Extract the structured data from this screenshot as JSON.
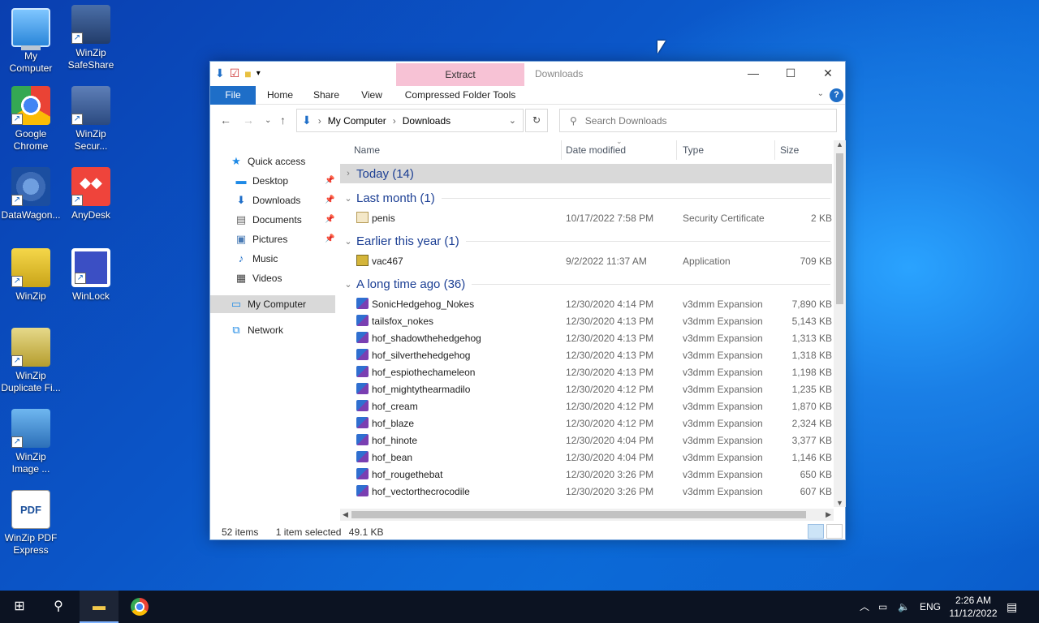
{
  "desktop": {
    "icons": [
      {
        "label": "My\nComputer",
        "l1": "My",
        "l2": "Computer"
      },
      {
        "l1": "WinZip",
        "l2": "SafeShare"
      },
      {
        "l1": "Google",
        "l2": "Chrome"
      },
      {
        "l1": "WinZip",
        "l2": "Secur..."
      },
      {
        "l1": "DataWagon...",
        "l2": ""
      },
      {
        "l1": "AnyDesk",
        "l2": ""
      },
      {
        "l1": "WinZip",
        "l2": ""
      },
      {
        "l1": "WinLock",
        "l2": ""
      },
      {
        "l1": "WinZip",
        "l2": "Duplicate Fi..."
      },
      {
        "l1": "WinZip",
        "l2": "Image ..."
      },
      {
        "l1": "WinZip PDF",
        "l2": "Express",
        "glyph": "PDF"
      }
    ]
  },
  "window": {
    "title": "Downloads",
    "extract_tab": "Extract",
    "ribbon_tabs": [
      "File",
      "Home",
      "Share",
      "View",
      "Compressed Folder Tools"
    ],
    "help": "?",
    "controls": {
      "minimize": "—",
      "maximize": "☐",
      "close": "✕"
    },
    "address": {
      "crumbs": [
        "My Computer",
        "Downloads"
      ],
      "sep": "›"
    },
    "search_placeholder": "Search Downloads"
  },
  "navpane": {
    "items": [
      {
        "label": "Quick access",
        "icon": "star-icon"
      },
      {
        "label": "Desktop",
        "icon": "desktop-icon",
        "pinned": true
      },
      {
        "label": "Downloads",
        "icon": "download-icon",
        "pinned": true
      },
      {
        "label": "Documents",
        "icon": "document-icon",
        "pinned": true
      },
      {
        "label": "Pictures",
        "icon": "pictures-icon",
        "pinned": true
      },
      {
        "label": "Music",
        "icon": "music-icon"
      },
      {
        "label": "Videos",
        "icon": "video-icon"
      },
      {
        "label": "My Computer",
        "icon": "computer-icon",
        "selected": true
      },
      {
        "label": "Network",
        "icon": "network-icon"
      }
    ]
  },
  "columns": [
    "Name",
    "Date modified",
    "Type",
    "Size"
  ],
  "groups": {
    "today": "Today (14)",
    "last_month": "Last month (1)",
    "earlier": "Earlier this year (1)",
    "long_ago": "A long time ago (36)"
  },
  "files": {
    "last_month": [
      {
        "name": "penis",
        "date": "10/17/2022 7:58 PM",
        "type": "Security Certificate",
        "size": "2 KB"
      }
    ],
    "earlier": [
      {
        "name": "vac467",
        "date": "9/2/2022 11:37 AM",
        "type": "Application",
        "size": "709 KB"
      }
    ],
    "long_ago": [
      {
        "name": "SonicHedgehog_Nokes",
        "date": "12/30/2020 4:14 PM",
        "type": "v3dmm Expansion",
        "size": "7,890 KB"
      },
      {
        "name": "tailsfox_nokes",
        "date": "12/30/2020 4:13 PM",
        "type": "v3dmm Expansion",
        "size": "5,143 KB"
      },
      {
        "name": "hof_shadowthehedgehog",
        "date": "12/30/2020 4:13 PM",
        "type": "v3dmm Expansion",
        "size": "1,313 KB"
      },
      {
        "name": "hof_silverthehedgehog",
        "date": "12/30/2020 4:13 PM",
        "type": "v3dmm Expansion",
        "size": "1,318 KB"
      },
      {
        "name": "hof_espiothechameleon",
        "date": "12/30/2020 4:13 PM",
        "type": "v3dmm Expansion",
        "size": "1,198 KB"
      },
      {
        "name": "hof_mightythearmadilo",
        "date": "12/30/2020 4:12 PM",
        "type": "v3dmm Expansion",
        "size": "1,235 KB"
      },
      {
        "name": "hof_cream",
        "date": "12/30/2020 4:12 PM",
        "type": "v3dmm Expansion",
        "size": "1,870 KB"
      },
      {
        "name": "hof_blaze",
        "date": "12/30/2020 4:12 PM",
        "type": "v3dmm Expansion",
        "size": "2,324 KB"
      },
      {
        "name": "hof_hinote",
        "date": "12/30/2020 4:04 PM",
        "type": "v3dmm Expansion",
        "size": "3,377 KB"
      },
      {
        "name": "hof_bean",
        "date": "12/30/2020 4:04 PM",
        "type": "v3dmm Expansion",
        "size": "1,146 KB"
      },
      {
        "name": "hof_rougethebat",
        "date": "12/30/2020 3:26 PM",
        "type": "v3dmm Expansion",
        "size": "650 KB"
      },
      {
        "name": "hof_vectorthecrocodile",
        "date": "12/30/2020 3:26 PM",
        "type": "v3dmm Expansion",
        "size": "607 KB"
      }
    ]
  },
  "status": {
    "items": "52 items",
    "selected": "1 item selected",
    "size": "49.1 KB"
  },
  "taskbar": {
    "lang": "ENG",
    "time": "2:26 AM",
    "date": "11/12/2022"
  },
  "colors": {
    "accent": "#1e6ec8",
    "group_text": "#1c3f94",
    "extract_tab": "#f7c2d5"
  }
}
